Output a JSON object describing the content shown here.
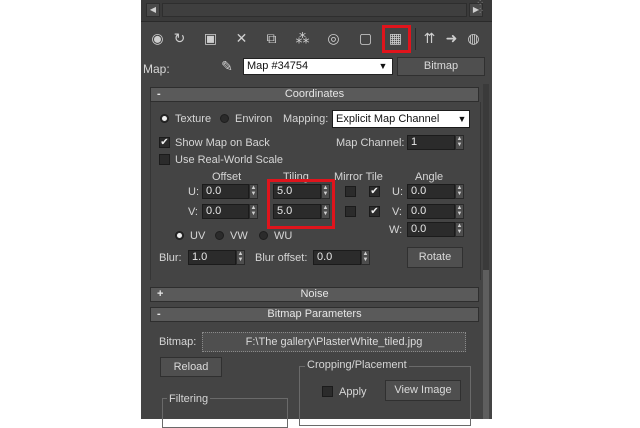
{
  "toolbar": {
    "icons": [
      "sample-sphere-icon",
      "put-to-scene-icon",
      "assign-material-icon",
      "reset-map-icon",
      "copy-material-icon",
      "make-unique-icon",
      "put-to-library-icon",
      "material-id-icon",
      "show-map-in-viewport-icon",
      "show-shaded-material-icon",
      "go-to-parent-icon",
      "go-forward-icon",
      "pick-material-icon"
    ]
  },
  "map": {
    "label": "Map:",
    "name": "Map #34754",
    "type_button": "Bitmap"
  },
  "coordinates": {
    "sign": "-",
    "title": "Coordinates",
    "texture_label": "Texture",
    "environ_label": "Environ",
    "mapping_label": "Mapping:",
    "mapping_value": "Explicit Map Channel",
    "show_map_on_back": "Show Map on Back",
    "map_channel_label": "Map Channel:",
    "map_channel_value": "1",
    "use_real_world_scale": "Use Real-World Scale",
    "offset_label": "Offset",
    "tiling_label": "Tiling",
    "mirror_tile_label": "Mirror Tile",
    "angle_label": "Angle",
    "u_label": "U:",
    "v_label": "V:",
    "w_label": "W:",
    "u_offset": "0.0",
    "v_offset": "0.0",
    "u_tiling": "5.0",
    "v_tiling": "5.0",
    "u_angle": "0.0",
    "v_angle": "0.0",
    "w_angle": "0.0",
    "uv_label": "UV",
    "vw_label": "VW",
    "wu_label": "WU",
    "blur_label": "Blur:",
    "blur_value": "1.0",
    "blur_offset_label": "Blur offset:",
    "blur_offset_value": "0.0",
    "rotate_button": "Rotate"
  },
  "noise": {
    "sign": "+",
    "title": "Noise"
  },
  "bitmap_params": {
    "sign": "-",
    "title": "Bitmap Parameters",
    "bitmap_label": "Bitmap:",
    "bitmap_path": "F:\\The gallery\\PlasterWhite_tiled.jpg",
    "reload_button": "Reload",
    "cropping_label": "Cropping/Placement",
    "apply_label": "Apply",
    "view_image_button": "View Image",
    "filtering_label": "Filtering"
  },
  "colors": {
    "panel_bg": "#444444",
    "highlight": "#e0141c",
    "input_bg": "#2b2b2b"
  }
}
